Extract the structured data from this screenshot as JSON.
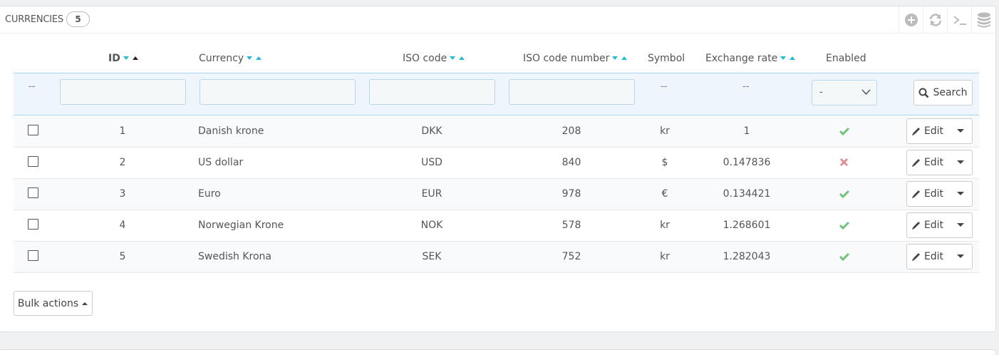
{
  "panel": {
    "title": "Currencies",
    "count": "5"
  },
  "toolbar": {
    "items": [
      {
        "icon": "add-circle-icon"
      },
      {
        "icon": "refresh-icon"
      },
      {
        "icon": "terminal-icon"
      },
      {
        "icon": "database-icon"
      }
    ]
  },
  "columns": {
    "id": "ID",
    "currency": "Currency",
    "iso_code": "ISO code",
    "iso_code_number": "ISO code number",
    "symbol": "Symbol",
    "exchange_rate": "Exchange rate",
    "enabled": "Enabled"
  },
  "filters": {
    "id_dash": "--",
    "symbol_dash": "--",
    "exchange_dash": "--",
    "enabled_value": "-",
    "search_label": "Search"
  },
  "rows": [
    {
      "id": "1",
      "currency": "Danish krone",
      "iso": "DKK",
      "iso_num": "208",
      "symbol": "kr",
      "rate": "1",
      "enabled": true
    },
    {
      "id": "2",
      "currency": "US dollar",
      "iso": "USD",
      "iso_num": "840",
      "symbol": "$",
      "rate": "0.147836",
      "enabled": false
    },
    {
      "id": "3",
      "currency": "Euro",
      "iso": "EUR",
      "iso_num": "978",
      "symbol": "€",
      "rate": "0.134421",
      "enabled": true
    },
    {
      "id": "4",
      "currency": "Norwegian Krone",
      "iso": "NOK",
      "iso_num": "578",
      "symbol": "kr",
      "rate": "1.268601",
      "enabled": true
    },
    {
      "id": "5",
      "currency": "Swedish Krona",
      "iso": "SEK",
      "iso_num": "752",
      "symbol": "kr",
      "rate": "1.282043",
      "enabled": true
    }
  ],
  "row_actions": {
    "edit_label": "Edit"
  },
  "bulk": {
    "label": "Bulk actions"
  },
  "colors": {
    "accent": "#25b9d7",
    "enabled": "#72c279",
    "disabled": "#e08f95"
  }
}
